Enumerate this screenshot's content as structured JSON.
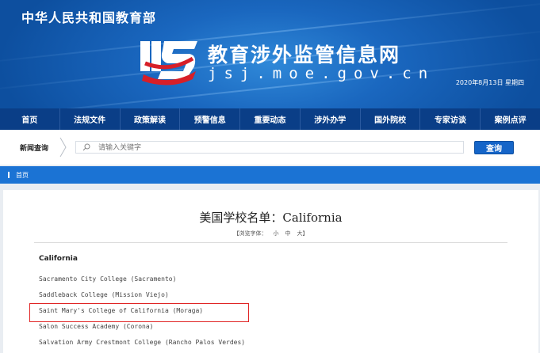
{
  "header": {
    "ministry": "中华人民共和国教育部",
    "site_title": "教育涉外监管信息网",
    "site_domain": "jsj.moe.gov.cn",
    "date": "2020年8月13日 星期四"
  },
  "nav": {
    "items": [
      "首页",
      "法规文件",
      "政策解读",
      "预警信息",
      "重要动态",
      "涉外办学",
      "国外院校",
      "专家访谈",
      "案例点评"
    ]
  },
  "search": {
    "label": "新闻查询",
    "placeholder": "请输入关键字",
    "button_label": "查询"
  },
  "breadcrumb": {
    "home": "首页"
  },
  "article": {
    "title": "美国学校名单：California",
    "font_size_prefix": "【浏览字体：",
    "font_small": "小",
    "font_medium": "中",
    "font_large": "大】",
    "section_heading": "California",
    "schools": [
      "Sacramento City College (Sacramento)",
      "Saddleback College (Mission Viejo)",
      "Saint Mary's College of California (Moraga)",
      "Salon Success Academy (Corona)",
      "Salvation Army Crestmont College (Rancho Palos Verdes)"
    ]
  },
  "colors": {
    "header_blue": "#1a67bf",
    "nav_blue": "#0a3e87",
    "breadcrumb_blue": "#1b73d4",
    "highlight_red": "#e02424"
  }
}
